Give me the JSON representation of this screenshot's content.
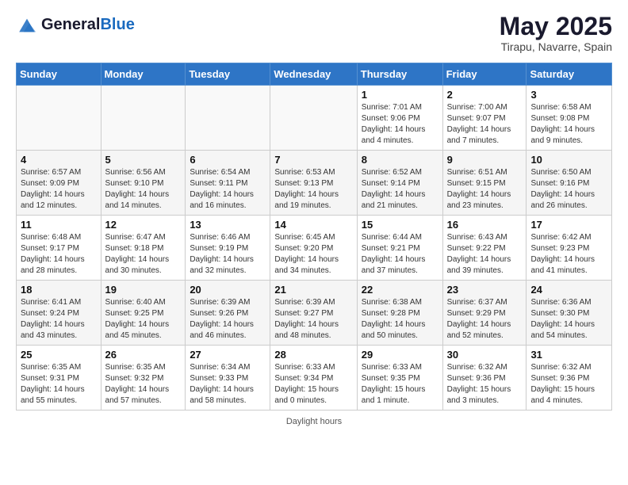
{
  "header": {
    "logo_general": "General",
    "logo_blue": "Blue",
    "month_title": "May 2025",
    "location": "Tirapu, Navarre, Spain"
  },
  "footer": {
    "note": "Daylight hours"
  },
  "days_of_week": [
    "Sunday",
    "Monday",
    "Tuesday",
    "Wednesday",
    "Thursday",
    "Friday",
    "Saturday"
  ],
  "weeks": [
    [
      {
        "num": "",
        "info": ""
      },
      {
        "num": "",
        "info": ""
      },
      {
        "num": "",
        "info": ""
      },
      {
        "num": "",
        "info": ""
      },
      {
        "num": "1",
        "info": "Sunrise: 7:01 AM\nSunset: 9:06 PM\nDaylight: 14 hours\nand 4 minutes."
      },
      {
        "num": "2",
        "info": "Sunrise: 7:00 AM\nSunset: 9:07 PM\nDaylight: 14 hours\nand 7 minutes."
      },
      {
        "num": "3",
        "info": "Sunrise: 6:58 AM\nSunset: 9:08 PM\nDaylight: 14 hours\nand 9 minutes."
      }
    ],
    [
      {
        "num": "4",
        "info": "Sunrise: 6:57 AM\nSunset: 9:09 PM\nDaylight: 14 hours\nand 12 minutes."
      },
      {
        "num": "5",
        "info": "Sunrise: 6:56 AM\nSunset: 9:10 PM\nDaylight: 14 hours\nand 14 minutes."
      },
      {
        "num": "6",
        "info": "Sunrise: 6:54 AM\nSunset: 9:11 PM\nDaylight: 14 hours\nand 16 minutes."
      },
      {
        "num": "7",
        "info": "Sunrise: 6:53 AM\nSunset: 9:13 PM\nDaylight: 14 hours\nand 19 minutes."
      },
      {
        "num": "8",
        "info": "Sunrise: 6:52 AM\nSunset: 9:14 PM\nDaylight: 14 hours\nand 21 minutes."
      },
      {
        "num": "9",
        "info": "Sunrise: 6:51 AM\nSunset: 9:15 PM\nDaylight: 14 hours\nand 23 minutes."
      },
      {
        "num": "10",
        "info": "Sunrise: 6:50 AM\nSunset: 9:16 PM\nDaylight: 14 hours\nand 26 minutes."
      }
    ],
    [
      {
        "num": "11",
        "info": "Sunrise: 6:48 AM\nSunset: 9:17 PM\nDaylight: 14 hours\nand 28 minutes."
      },
      {
        "num": "12",
        "info": "Sunrise: 6:47 AM\nSunset: 9:18 PM\nDaylight: 14 hours\nand 30 minutes."
      },
      {
        "num": "13",
        "info": "Sunrise: 6:46 AM\nSunset: 9:19 PM\nDaylight: 14 hours\nand 32 minutes."
      },
      {
        "num": "14",
        "info": "Sunrise: 6:45 AM\nSunset: 9:20 PM\nDaylight: 14 hours\nand 34 minutes."
      },
      {
        "num": "15",
        "info": "Sunrise: 6:44 AM\nSunset: 9:21 PM\nDaylight: 14 hours\nand 37 minutes."
      },
      {
        "num": "16",
        "info": "Sunrise: 6:43 AM\nSunset: 9:22 PM\nDaylight: 14 hours\nand 39 minutes."
      },
      {
        "num": "17",
        "info": "Sunrise: 6:42 AM\nSunset: 9:23 PM\nDaylight: 14 hours\nand 41 minutes."
      }
    ],
    [
      {
        "num": "18",
        "info": "Sunrise: 6:41 AM\nSunset: 9:24 PM\nDaylight: 14 hours\nand 43 minutes."
      },
      {
        "num": "19",
        "info": "Sunrise: 6:40 AM\nSunset: 9:25 PM\nDaylight: 14 hours\nand 45 minutes."
      },
      {
        "num": "20",
        "info": "Sunrise: 6:39 AM\nSunset: 9:26 PM\nDaylight: 14 hours\nand 46 minutes."
      },
      {
        "num": "21",
        "info": "Sunrise: 6:39 AM\nSunset: 9:27 PM\nDaylight: 14 hours\nand 48 minutes."
      },
      {
        "num": "22",
        "info": "Sunrise: 6:38 AM\nSunset: 9:28 PM\nDaylight: 14 hours\nand 50 minutes."
      },
      {
        "num": "23",
        "info": "Sunrise: 6:37 AM\nSunset: 9:29 PM\nDaylight: 14 hours\nand 52 minutes."
      },
      {
        "num": "24",
        "info": "Sunrise: 6:36 AM\nSunset: 9:30 PM\nDaylight: 14 hours\nand 54 minutes."
      }
    ],
    [
      {
        "num": "25",
        "info": "Sunrise: 6:35 AM\nSunset: 9:31 PM\nDaylight: 14 hours\nand 55 minutes."
      },
      {
        "num": "26",
        "info": "Sunrise: 6:35 AM\nSunset: 9:32 PM\nDaylight: 14 hours\nand 57 minutes."
      },
      {
        "num": "27",
        "info": "Sunrise: 6:34 AM\nSunset: 9:33 PM\nDaylight: 14 hours\nand 58 minutes."
      },
      {
        "num": "28",
        "info": "Sunrise: 6:33 AM\nSunset: 9:34 PM\nDaylight: 15 hours\nand 0 minutes."
      },
      {
        "num": "29",
        "info": "Sunrise: 6:33 AM\nSunset: 9:35 PM\nDaylight: 15 hours\nand 1 minute."
      },
      {
        "num": "30",
        "info": "Sunrise: 6:32 AM\nSunset: 9:36 PM\nDaylight: 15 hours\nand 3 minutes."
      },
      {
        "num": "31",
        "info": "Sunrise: 6:32 AM\nSunset: 9:36 PM\nDaylight: 15 hours\nand 4 minutes."
      }
    ]
  ]
}
